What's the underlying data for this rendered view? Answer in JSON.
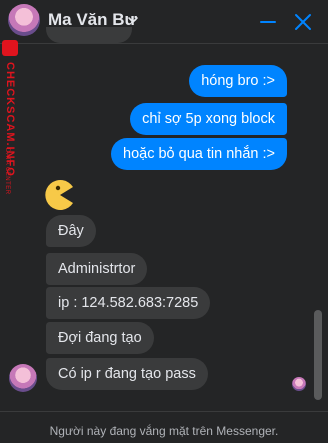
{
  "header": {
    "title": "Ma Văn Bư",
    "icons": {
      "dropdown": "chevron-down-icon",
      "minimize": "minimize-icon",
      "close": "close-icon"
    }
  },
  "watermark": {
    "small": "DATA CENTER",
    "big": "CHECKSCAM.INFO"
  },
  "messages": {
    "outgoing": [
      "hóng bro :>",
      "chỉ sợ 5p xong block",
      "hoặc bỏ qua tin nhắn :>"
    ],
    "incoming": [
      "Đây",
      "Administrtor",
      "ip : 124.582.683:7285",
      "Đợi đang tạo",
      "Có ip r đang tạo pass"
    ]
  },
  "footer": {
    "status": "Người này đang vắng mặt trên Messenger."
  },
  "colors": {
    "background": "#242526",
    "outgoing_bubble": "#0084ff",
    "incoming_bubble": "#3a3b3c",
    "accent": "#0084ff",
    "watermark": "#e0141e"
  }
}
